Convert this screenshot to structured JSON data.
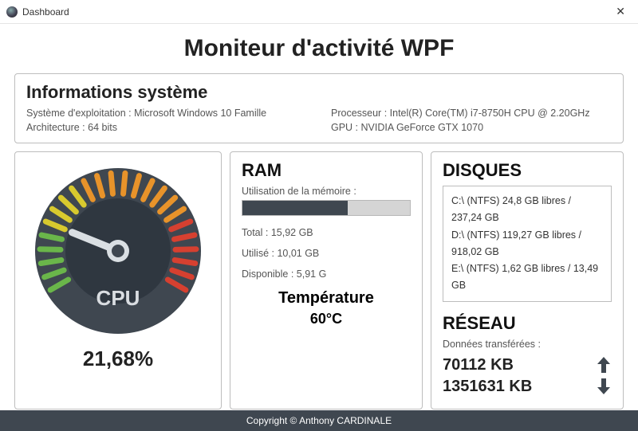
{
  "window": {
    "title": "Dashboard"
  },
  "header": {
    "title": "Moniteur d'activité WPF"
  },
  "sysinfo": {
    "heading": "Informations système",
    "os_label": "Système d'exploitation : Microsoft Windows 10 Famille",
    "arch_label": "Architecture : 64 bits",
    "cpu_label": "Processeur : Intel(R) Core(TM) i7-8750H CPU @ 2.20GHz",
    "gpu_label": "GPU : NVIDIA GeForce GTX 1070"
  },
  "cpu": {
    "gauge_label": "CPU",
    "percent_text": "21,68%",
    "percent_value": 21.68
  },
  "ram": {
    "heading": "RAM",
    "usage_label": "Utilisation de la mémoire :",
    "total_line": "Total : 15,92 GB",
    "used_line": "Utilisé : 10,01 GB",
    "avail_line": "Disponible : 5,91 G",
    "fill_percent": 63,
    "temp_heading": "Température",
    "temp_value": "60°C"
  },
  "disks": {
    "heading": "DISQUES",
    "items": [
      "C:\\ (NTFS) 24,8 GB libres / 237,24 GB",
      "D:\\ (NTFS) 119,27 GB libres / 918,02 GB",
      "E:\\ (NTFS) 1,62 GB libres / 13,49 GB"
    ]
  },
  "network": {
    "heading": "RÉSEAU",
    "label": "Données transférées :",
    "up_text": "70112 KB",
    "down_text": "1351631 KB"
  },
  "footer": {
    "copyright": "Copyright © Anthony CARDINALE"
  }
}
